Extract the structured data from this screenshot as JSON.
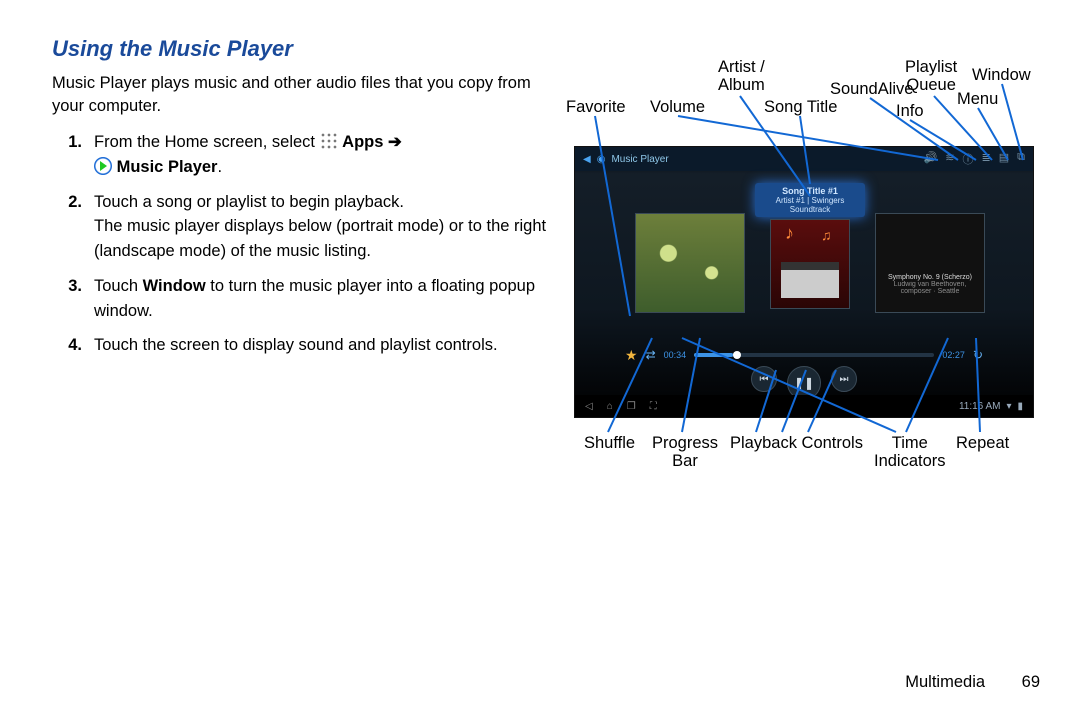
{
  "heading": "Using the Music Player",
  "intro": "Music Player plays music and other audio files that you copy from your computer.",
  "steps": {
    "s1a": "From the Home screen, select ",
    "s1_apps": "Apps",
    "s1_mp": "Music Player",
    "s1_end": ".",
    "s2": "Touch a song or playlist to begin playback.",
    "s2b": "The music player displays below (portrait mode) or to the right (landscape mode) of the music listing.",
    "s3a": "Touch ",
    "s3_win": "Window",
    "s3b": " to turn the music player into a floating popup window.",
    "s4": "Touch the screen to display sound and playlist controls."
  },
  "nums": {
    "n1": "1.",
    "n2": "2.",
    "n3": "3.",
    "n4": "4."
  },
  "labels": {
    "favorite": "Favorite",
    "volume": "Volume",
    "artist_album": "Artist /\nAlbum",
    "song_title": "Song Title",
    "soundalive": "SoundAlive",
    "info": "Info",
    "playlist_queue": "Playlist\nQueue",
    "menu": "Menu",
    "window": "Window",
    "shuffle": "Shuffle",
    "progress_bar": "Progress\nBar",
    "playback_controls": "Playback Controls",
    "time_indicators": "Time\nIndicators",
    "repeat": "Repeat"
  },
  "device": {
    "app_title": "Music Player",
    "song_title": "Song Title #1",
    "song_sub": "Artist #1 | Swingers Soundtrack",
    "right_title": "Symphony No. 9 (Scherzo)",
    "right_sub": "Ludwig van Beethoven, composer · Seattle",
    "time_cur": "00:34",
    "time_tot": "02:27",
    "clock": "11:16 AM"
  },
  "footer": {
    "section": "Multimedia",
    "page": "69"
  }
}
